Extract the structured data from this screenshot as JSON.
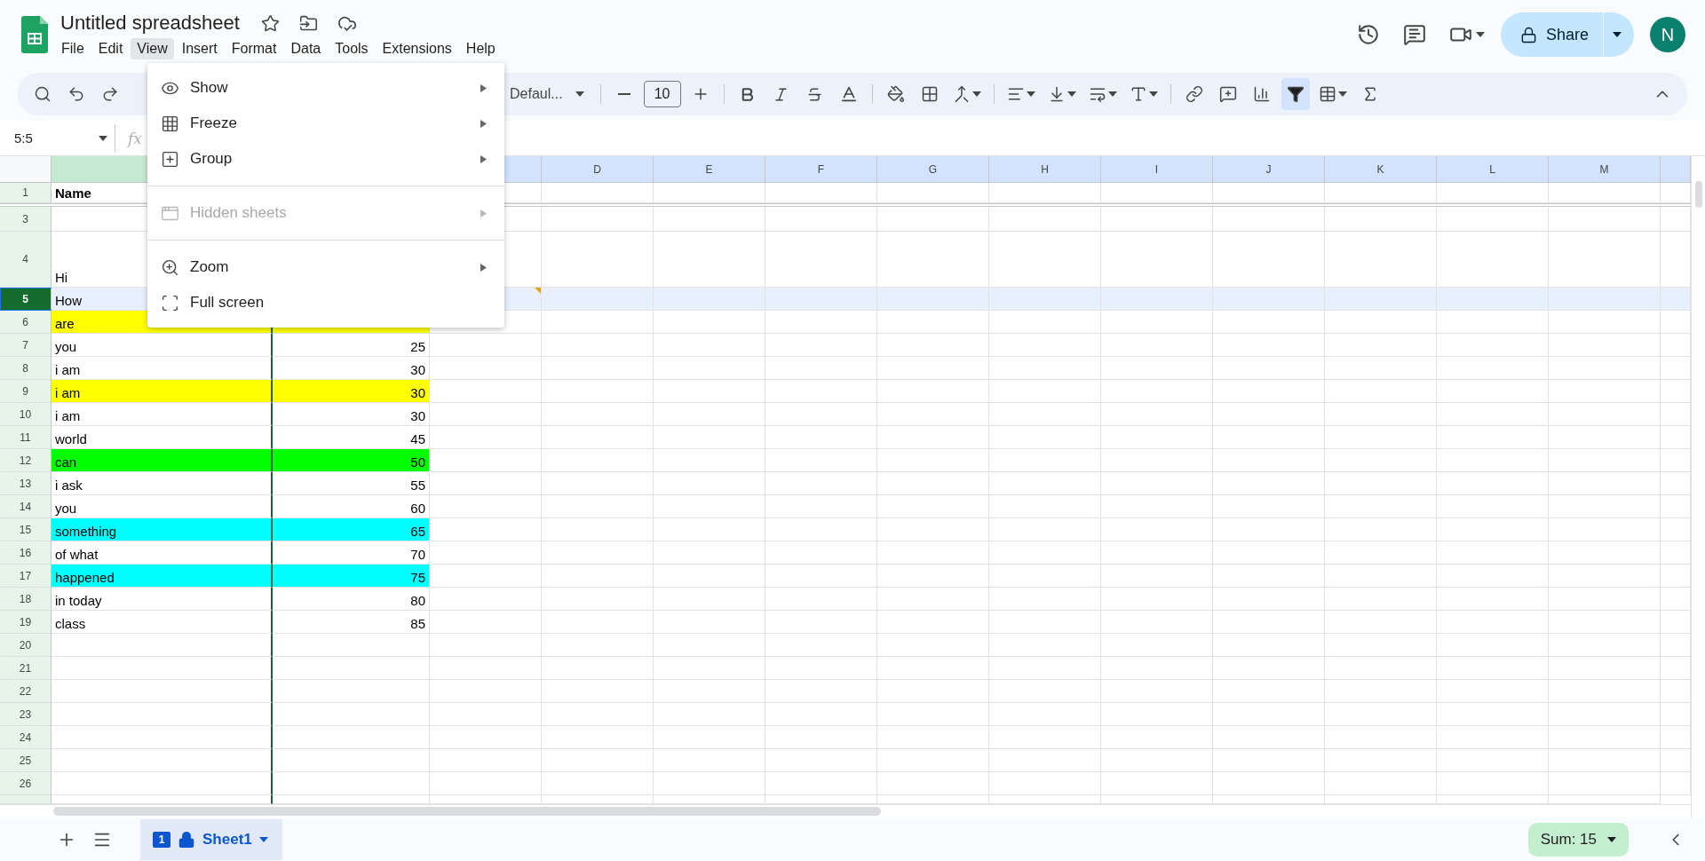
{
  "app": {
    "title": "Untitled spreadsheet",
    "avatar": "N"
  },
  "menu_bar": [
    {
      "label": "File",
      "selected": false
    },
    {
      "label": "Edit",
      "selected": false
    },
    {
      "label": "View",
      "selected": true
    },
    {
      "label": "Insert",
      "selected": false
    },
    {
      "label": "Format",
      "selected": false
    },
    {
      "label": "Data",
      "selected": false
    },
    {
      "label": "Tools",
      "selected": false
    },
    {
      "label": "Extensions",
      "selected": false
    },
    {
      "label": "Help",
      "selected": false
    }
  ],
  "share_button": {
    "label": "Share"
  },
  "toolbar": {
    "font": "Defaul...",
    "font_size": "10",
    "filter_on": true
  },
  "formula_bar": {
    "name_box": "5:5",
    "fx": "fx"
  },
  "view_menu": [
    {
      "kind": "item",
      "label": "Show",
      "submenu": true,
      "disabled": false
    },
    {
      "kind": "item",
      "label": "Freeze",
      "submenu": true,
      "disabled": false
    },
    {
      "kind": "item",
      "label": "Group",
      "submenu": true,
      "disabled": false
    },
    {
      "kind": "divider"
    },
    {
      "kind": "item",
      "label": "Hidden sheets",
      "submenu": true,
      "disabled": true
    },
    {
      "kind": "divider"
    },
    {
      "kind": "item",
      "label": "Zoom",
      "submenu": true,
      "disabled": false
    },
    {
      "kind": "item",
      "label": "Full screen",
      "submenu": false,
      "disabled": false
    }
  ],
  "column_headers": [
    "D",
    "E",
    "F",
    "G",
    "H",
    "I",
    "J",
    "K",
    "L",
    "M"
  ],
  "rows": [
    {
      "number": "1",
      "kind": "header",
      "column_a": "Name",
      "selected": false,
      "note": false
    },
    {
      "number": "3",
      "kind": "data",
      "selected": false,
      "note": false
    },
    {
      "number": "4",
      "kind": "data",
      "column_a": "Hi",
      "selected": false,
      "note": false
    },
    {
      "number": "5",
      "kind": "data",
      "column_a": "How",
      "selected": true,
      "note": true
    },
    {
      "number": "6",
      "kind": "data",
      "column_a": "are",
      "color": "#ffff00",
      "selected": false,
      "note": false
    },
    {
      "number": "7",
      "kind": "data",
      "column_a": "you",
      "column_b": "25",
      "selected": false,
      "note": false
    },
    {
      "number": "8",
      "kind": "data",
      "column_a": "i am",
      "column_b": "30",
      "selected": false,
      "note": false
    },
    {
      "number": "9",
      "kind": "data",
      "column_a": "i am",
      "column_b": "30",
      "color": "#ffff00",
      "selected": false,
      "note": false
    },
    {
      "number": "10",
      "kind": "data",
      "column_a": "i am",
      "column_b": "30",
      "selected": false,
      "note": false
    },
    {
      "number": "11",
      "kind": "data",
      "column_a": "world",
      "column_b": "45",
      "selected": false,
      "note": false
    },
    {
      "number": "12",
      "kind": "data",
      "column_a": "can",
      "column_b": "50",
      "color": "#00ff00",
      "selected": false,
      "note": false
    },
    {
      "number": "13",
      "kind": "data",
      "column_a": "i ask",
      "column_b": "55",
      "selected": false,
      "note": false
    },
    {
      "number": "14",
      "kind": "data",
      "column_a": "you",
      "column_b": "60",
      "selected": false,
      "note": false
    },
    {
      "number": "15",
      "kind": "data",
      "column_a": "something",
      "column_b": "65",
      "color": "#00ffff",
      "selected": false,
      "note": false
    },
    {
      "number": "16",
      "kind": "data",
      "column_a": "of what",
      "column_b": "70",
      "selected": false,
      "note": false
    },
    {
      "number": "17",
      "kind": "data",
      "column_a": "happened",
      "column_b": "75",
      "color": "#00ffff",
      "selected": false,
      "note": false
    },
    {
      "number": "18",
      "kind": "data",
      "column_a": "in today",
      "column_b": "80",
      "selected": false,
      "note": false
    },
    {
      "number": "19",
      "kind": "data",
      "column_a": "class",
      "column_b": "85",
      "selected": false,
      "note": false
    },
    {
      "number": "20",
      "kind": "data",
      "selected": false,
      "note": false
    },
    {
      "number": "21",
      "kind": "data",
      "selected": false,
      "note": false
    },
    {
      "number": "22",
      "kind": "data",
      "selected": false,
      "note": false
    },
    {
      "number": "23",
      "kind": "data",
      "selected": false,
      "note": false
    },
    {
      "number": "24",
      "kind": "data",
      "selected": false,
      "note": false
    },
    {
      "number": "25",
      "kind": "data",
      "selected": false,
      "note": false
    },
    {
      "number": "26",
      "kind": "data",
      "selected": false,
      "note": false
    }
  ],
  "sheet_tab": {
    "label": "Sheet1",
    "badge": "1",
    "selected": true
  },
  "sum": {
    "label": "Sum: 15"
  }
}
